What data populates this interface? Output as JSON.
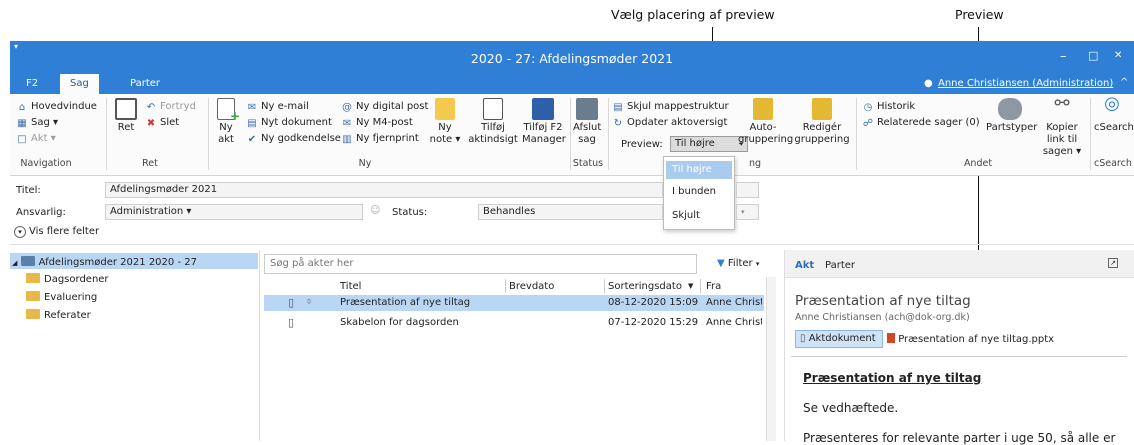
{
  "callouts": {
    "left": "Vælg placering af preview",
    "right": "Preview"
  },
  "window": {
    "title": "2020 - 27: Afdelingsmøder 2021",
    "min": "–",
    "max": "□",
    "close": "✕"
  },
  "tabs": [
    "F2",
    "Sag",
    "Parter"
  ],
  "user": "Anne Christiansen (Administration)",
  "ribbon": {
    "nav": {
      "hovedvindue": "Hovedvindue",
      "sag": "Sag ▾",
      "akt": "Akt ▾",
      "group": "Navigation"
    },
    "ret": {
      "ret": "Ret",
      "fortryd": "Fortryd",
      "slet": "Slet",
      "group": "Ret"
    },
    "ny": {
      "nyakt": "Ny akt",
      "email": "Ny e-mail",
      "dokument": "Nyt dokument",
      "godkendelse": "Ny godkendelse",
      "digitalpost": "Ny digital post",
      "m4": "Ny M4-post",
      "fjernprint": "Ny fjernprint",
      "note": "Ny note ▾",
      "aktindsigt": "Tilføj aktindsigt",
      "f2manager": "Tilføj F2 Manager",
      "group": "Ny"
    },
    "status": {
      "afslut": "Afslut sag",
      "group": "Status"
    },
    "visning": {
      "skjul": "Skjul mappestruktur",
      "opdater": "Opdater aktoversigt",
      "preview_label": "Preview:",
      "preview_value": "Til højre",
      "autogruppering": "Auto-gruppering",
      "rediger": "Redigér gruppering",
      "group": "ng"
    },
    "andet": {
      "historik": "Historik",
      "relaterede": "Relaterede sager (0)",
      "partstyper": "Partstyper",
      "kopier": "Kopier link til sagen ▾",
      "group": "Andet"
    },
    "csearch": {
      "label": "cSearch",
      "group": "cSearch"
    }
  },
  "dropdown": [
    "Til højre",
    "I bunden",
    "Skjult"
  ],
  "form": {
    "titel_label": "Titel:",
    "titel_value": "Afdelingsmøder 2021",
    "ansvarlig_label": "Ansvarlig:",
    "ansvarlig_value": "Administration ▾",
    "status_label": "Status:",
    "status_value": "Behandles",
    "more": "Vis flere felter"
  },
  "tree": {
    "root": "Afdelingsmøder 2021 2020 - 27",
    "children": [
      "Dagsordener",
      "Evaluering",
      "Referater"
    ]
  },
  "list": {
    "search_placeholder": "Søg på akter her",
    "filter": "Filter",
    "columns": [
      "Titel",
      "Brevdato",
      "Sorteringsdato",
      "Fra"
    ],
    "rows": [
      {
        "title": "Præsentation af nye tiltag",
        "brevdato": "",
        "sort": "08-12-2020 15:09",
        "fra": "Anne Christi"
      },
      {
        "title": "Skabelon for dagsorden",
        "brevdato": "",
        "sort": "07-12-2020 15:29",
        "fra": "Anne Christi"
      }
    ]
  },
  "preview": {
    "tabs": [
      "Akt",
      "Parter"
    ],
    "title": "Præsentation af nye tiltag",
    "sender": "Anne Christiansen (ach@dok-org.dk)",
    "aktdok": "Aktdokument",
    "attachment": "Præsentation af nye tiltag.pptx",
    "heading": "Præsentation af nye tiltag",
    "body1": "Se vedhæftede.",
    "body2": "Præsenteres for relevante parter i uge 50, så alle er"
  },
  "colors": {
    "accent": "#2e7fd5",
    "selection": "#b9d7f5"
  }
}
